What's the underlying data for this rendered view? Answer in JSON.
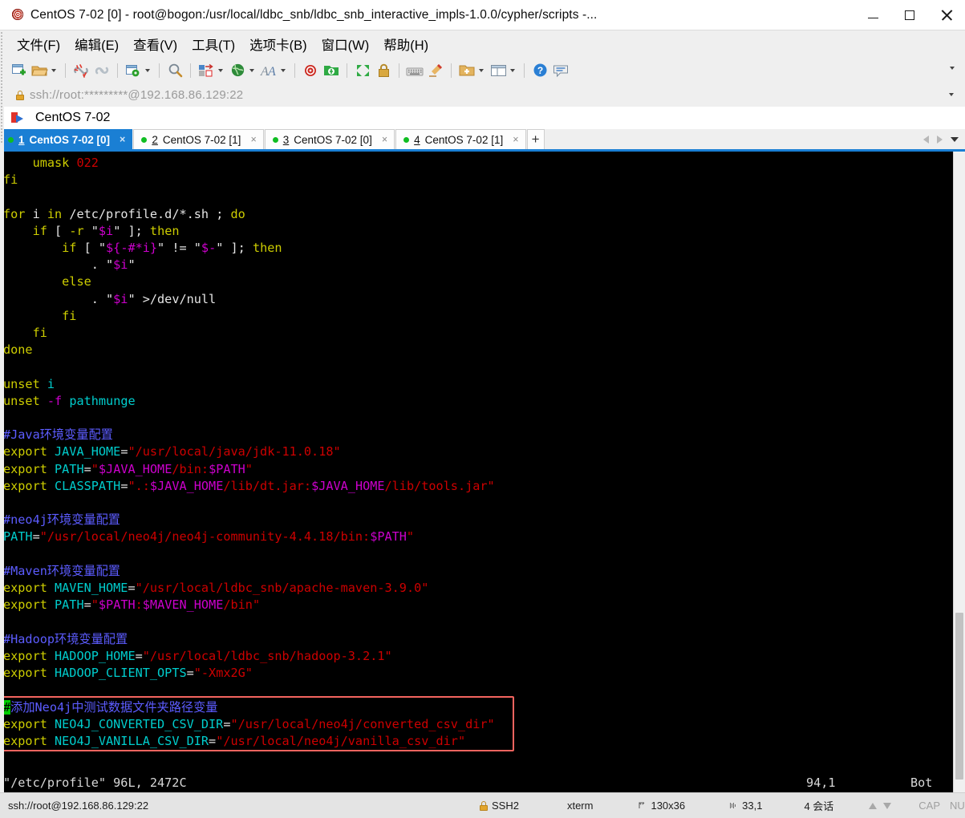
{
  "window": {
    "title": "CentOS 7-02 [0] - root@bogon:/usr/local/ldbc_snb/ldbc_snb_interactive_impls-1.0.0/cypher/scripts -...",
    "app_icon": "snail-icon",
    "minimize": "─",
    "maximize": "□",
    "close": "×"
  },
  "menubar": {
    "items": [
      {
        "label": "文件(F)",
        "name": "menu-file"
      },
      {
        "label": "编辑(E)",
        "name": "menu-edit"
      },
      {
        "label": "查看(V)",
        "name": "menu-view"
      },
      {
        "label": "工具(T)",
        "name": "menu-tools"
      },
      {
        "label": "选项卡(B)",
        "name": "menu-tabs"
      },
      {
        "label": "窗口(W)",
        "name": "menu-window"
      },
      {
        "label": "帮助(H)",
        "name": "menu-help"
      }
    ]
  },
  "toolbar": {
    "icons": [
      "new-session-icon",
      "open-folder-icon",
      "disconnect-icon",
      "connect-icon",
      "session-options-icon",
      "search-icon",
      "transfer-icon",
      "globe-icon",
      "font-icon",
      "snail-icon",
      "file-manager-icon",
      "fullscreen-icon",
      "lock-icon",
      "keyboard-icon",
      "highlighter-icon",
      "add-folder-icon",
      "layout-icon",
      "help-icon",
      "comment-icon"
    ]
  },
  "address": {
    "icon": "lock-icon",
    "value": "ssh://root:*********@192.168.86.129:22"
  },
  "session_header": {
    "icon": "session-flag-icon",
    "label": "CentOS 7-02"
  },
  "tabs": {
    "items": [
      {
        "index": "1",
        "label": " CentOS 7-02 [0]",
        "active": true
      },
      {
        "index": "2",
        "label": " CentOS 7-02 [1]",
        "active": false
      },
      {
        "index": "3",
        "label": " CentOS 7-02 [0]",
        "active": false
      },
      {
        "index": "4",
        "label": " CentOS 7-02 [1]",
        "active": false
      }
    ],
    "add_label": "+",
    "close_label": "×"
  },
  "terminal": {
    "lines": [
      [
        {
          "t": "    umask ",
          "c": "yellow"
        },
        {
          "t": "022",
          "c": "red"
        }
      ],
      [
        {
          "t": "fi",
          "c": "yellow"
        }
      ],
      [
        {
          "t": "",
          "c": "white"
        }
      ],
      [
        {
          "t": "for",
          "c": "yellow"
        },
        {
          "t": " i ",
          "c": "white"
        },
        {
          "t": "in",
          "c": "yellow"
        },
        {
          "t": " /etc/profile.d/*.sh ; ",
          "c": "white"
        },
        {
          "t": "do",
          "c": "yellow"
        }
      ],
      [
        {
          "t": "    ",
          "c": "white"
        },
        {
          "t": "if",
          "c": "yellow"
        },
        {
          "t": " [ ",
          "c": "white"
        },
        {
          "t": "-r",
          "c": "yellow"
        },
        {
          "t": " \"",
          "c": "white"
        },
        {
          "t": "$i",
          "c": "mag"
        },
        {
          "t": "\" ]; ",
          "c": "white"
        },
        {
          "t": "then",
          "c": "yellow"
        }
      ],
      [
        {
          "t": "        ",
          "c": "white"
        },
        {
          "t": "if",
          "c": "yellow"
        },
        {
          "t": " [ \"",
          "c": "white"
        },
        {
          "t": "${-#*i}",
          "c": "mag"
        },
        {
          "t": "\" != \"",
          "c": "white"
        },
        {
          "t": "$-",
          "c": "mag"
        },
        {
          "t": "\" ]; ",
          "c": "white"
        },
        {
          "t": "then",
          "c": "yellow"
        }
      ],
      [
        {
          "t": "            . \"",
          "c": "white"
        },
        {
          "t": "$i",
          "c": "mag"
        },
        {
          "t": "\"",
          "c": "white"
        }
      ],
      [
        {
          "t": "        ",
          "c": "white"
        },
        {
          "t": "else",
          "c": "yellow"
        }
      ],
      [
        {
          "t": "            . \"",
          "c": "white"
        },
        {
          "t": "$i",
          "c": "mag"
        },
        {
          "t": "\" >/dev/null",
          "c": "white"
        }
      ],
      [
        {
          "t": "        fi",
          "c": "yellow"
        }
      ],
      [
        {
          "t": "    fi",
          "c": "yellow"
        }
      ],
      [
        {
          "t": "done",
          "c": "yellow"
        }
      ],
      [
        {
          "t": "",
          "c": "white"
        }
      ],
      [
        {
          "t": "unset",
          "c": "yellow"
        },
        {
          "t": " i",
          "c": "cyan"
        }
      ],
      [
        {
          "t": "unset",
          "c": "yellow"
        },
        {
          "t": " ",
          "c": "white"
        },
        {
          "t": "-f",
          "c": "mag"
        },
        {
          "t": " ",
          "c": "white"
        },
        {
          "t": "pathmunge",
          "c": "cyan"
        }
      ],
      [
        {
          "t": "",
          "c": "white"
        }
      ],
      [
        {
          "t": "#Java环境变量配置",
          "c": "blue"
        }
      ],
      [
        {
          "t": "export",
          "c": "yellow"
        },
        {
          "t": " JAVA_HOME",
          "c": "cyan"
        },
        {
          "t": "=",
          "c": "white"
        },
        {
          "t": "\"/usr/local/java/jdk-11.0.18\"",
          "c": "red"
        }
      ],
      [
        {
          "t": "export",
          "c": "yellow"
        },
        {
          "t": " PATH",
          "c": "cyan"
        },
        {
          "t": "=",
          "c": "white"
        },
        {
          "t": "\"",
          "c": "red"
        },
        {
          "t": "$JAVA_HOME",
          "c": "mag"
        },
        {
          "t": "/bin:",
          "c": "red"
        },
        {
          "t": "$PATH",
          "c": "mag"
        },
        {
          "t": "\"",
          "c": "red"
        }
      ],
      [
        {
          "t": "export",
          "c": "yellow"
        },
        {
          "t": " CLASSPATH",
          "c": "cyan"
        },
        {
          "t": "=",
          "c": "white"
        },
        {
          "t": "\".:",
          "c": "red"
        },
        {
          "t": "$JAVA_HOME",
          "c": "mag"
        },
        {
          "t": "/lib/dt.jar:",
          "c": "red"
        },
        {
          "t": "$JAVA_HOME",
          "c": "mag"
        },
        {
          "t": "/lib/tools.jar\"",
          "c": "red"
        }
      ],
      [
        {
          "t": "",
          "c": "white"
        }
      ],
      [
        {
          "t": "#neo4j环境变量配置",
          "c": "blue"
        }
      ],
      [
        {
          "t": "PATH",
          "c": "cyan"
        },
        {
          "t": "=",
          "c": "white"
        },
        {
          "t": "\"/usr/local/neo4j/neo4j-community-4.4.18/bin:",
          "c": "red"
        },
        {
          "t": "$PATH",
          "c": "mag"
        },
        {
          "t": "\"",
          "c": "red"
        }
      ],
      [
        {
          "t": "",
          "c": "white"
        }
      ],
      [
        {
          "t": "#Maven环境变量配置",
          "c": "blue"
        }
      ],
      [
        {
          "t": "export",
          "c": "yellow"
        },
        {
          "t": " MAVEN_HOME",
          "c": "cyan"
        },
        {
          "t": "=",
          "c": "white"
        },
        {
          "t": "\"/usr/local/ldbc_snb/apache-maven-3.9.0\"",
          "c": "red"
        }
      ],
      [
        {
          "t": "export",
          "c": "yellow"
        },
        {
          "t": " PATH",
          "c": "cyan"
        },
        {
          "t": "=",
          "c": "white"
        },
        {
          "t": "\"",
          "c": "red"
        },
        {
          "t": "$PATH",
          "c": "mag"
        },
        {
          "t": ":",
          "c": "red"
        },
        {
          "t": "$MAVEN_HOME",
          "c": "mag"
        },
        {
          "t": "/bin\"",
          "c": "red"
        }
      ],
      [
        {
          "t": "",
          "c": "white"
        }
      ],
      [
        {
          "t": "#Hadoop环境变量配置",
          "c": "blue"
        }
      ],
      [
        {
          "t": "export",
          "c": "yellow"
        },
        {
          "t": " HADOOP_HOME",
          "c": "cyan"
        },
        {
          "t": "=",
          "c": "white"
        },
        {
          "t": "\"/usr/local/ldbc_snb/hadoop-3.2.1\"",
          "c": "red"
        }
      ],
      [
        {
          "t": "export",
          "c": "yellow"
        },
        {
          "t": " HADOOP_CLIENT_OPTS",
          "c": "cyan"
        },
        {
          "t": "=",
          "c": "white"
        },
        {
          "t": "\"-Xmx2G\"",
          "c": "red"
        }
      ],
      [
        {
          "t": "",
          "c": "white"
        }
      ],
      [
        {
          "t": "#",
          "c": "cursor"
        },
        {
          "t": "添加Neo4j中测试数据文件夹路径变量",
          "c": "blue"
        }
      ],
      [
        {
          "t": "export",
          "c": "yellow"
        },
        {
          "t": " NEO4J_CONVERTED_CSV_DIR",
          "c": "cyan"
        },
        {
          "t": "=",
          "c": "white"
        },
        {
          "t": "\"/usr/local/neo4j/converted_csv_dir\"",
          "c": "red"
        }
      ],
      [
        {
          "t": "export",
          "c": "yellow"
        },
        {
          "t": " NEO4J_VANILLA_CSV_DIR",
          "c": "cyan"
        },
        {
          "t": "=",
          "c": "white"
        },
        {
          "t": "\"/usr/local/neo4j/vanilla_csv_dir\"",
          "c": "red"
        }
      ]
    ],
    "statusline": {
      "file": "\"/etc/profile\" 96L, 2472C",
      "position": "94,1",
      "scroll": "Bot"
    },
    "highlight_color": "#f4645f"
  },
  "statusbar": {
    "connection": "ssh://root@192.168.86.129:22",
    "protocol": "SSH2",
    "terminal_type": "xterm",
    "size": "130x36",
    "cursor": "33,1",
    "sessions": "4 会话",
    "cap": "CAP",
    "num": "NUM"
  }
}
